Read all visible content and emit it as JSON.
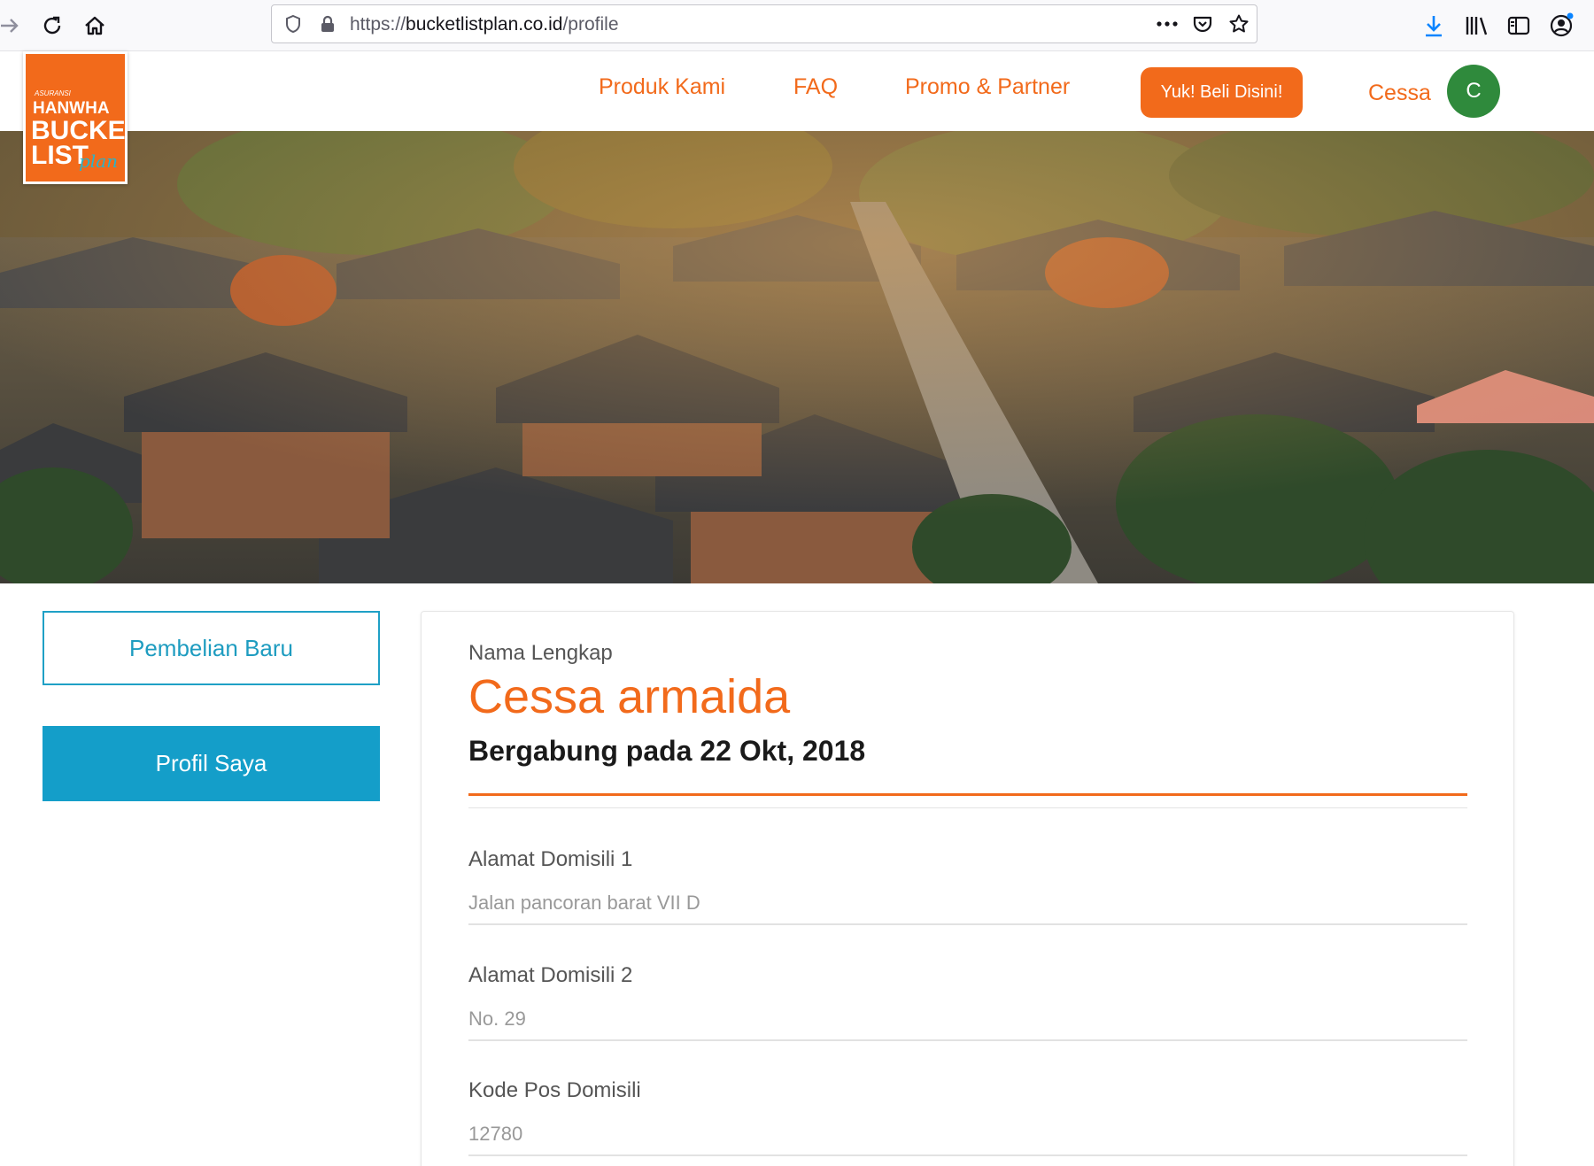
{
  "browser": {
    "url_prefix": "https://",
    "url_host": "bucketlistplan.co.id",
    "url_path": "/profile",
    "icons": [
      "forward-icon",
      "reload-icon",
      "home-icon",
      "shield-icon",
      "lock-icon",
      "more-icon",
      "pocket-icon",
      "bookmark-star-icon",
      "download-icon",
      "library-icon",
      "sidebar-icon",
      "account-icon"
    ]
  },
  "logo": {
    "line1": "ASURANSI",
    "line2": "HANWHA",
    "line3": "BUCKET",
    "line4": "LIST",
    "line5": "plan"
  },
  "nav": {
    "items": [
      "Produk Kami",
      "FAQ",
      "Promo & Partner"
    ],
    "cta_label": "Yuk! Beli Disini!",
    "user_name": "Cessa",
    "avatar_initial": "C"
  },
  "sidebar": {
    "new_purchase": "Pembelian Baru",
    "my_profile": "Profil Saya"
  },
  "profile": {
    "name_label": "Nama Lengkap",
    "full_name": "Cessa armaida",
    "joined": "Bergabung pada 22 Okt, 2018",
    "fields": [
      {
        "label": "Alamat Domisili 1",
        "value": "Jalan pancoran barat VII D"
      },
      {
        "label": "Alamat Domisili 2",
        "value": "No. 29"
      },
      {
        "label": "Kode Pos Domisili",
        "value": "12780"
      }
    ]
  },
  "colors": {
    "brand_orange": "#f26a1b",
    "brand_blue": "#149ec9",
    "avatar_green": "#2f8a3c"
  }
}
